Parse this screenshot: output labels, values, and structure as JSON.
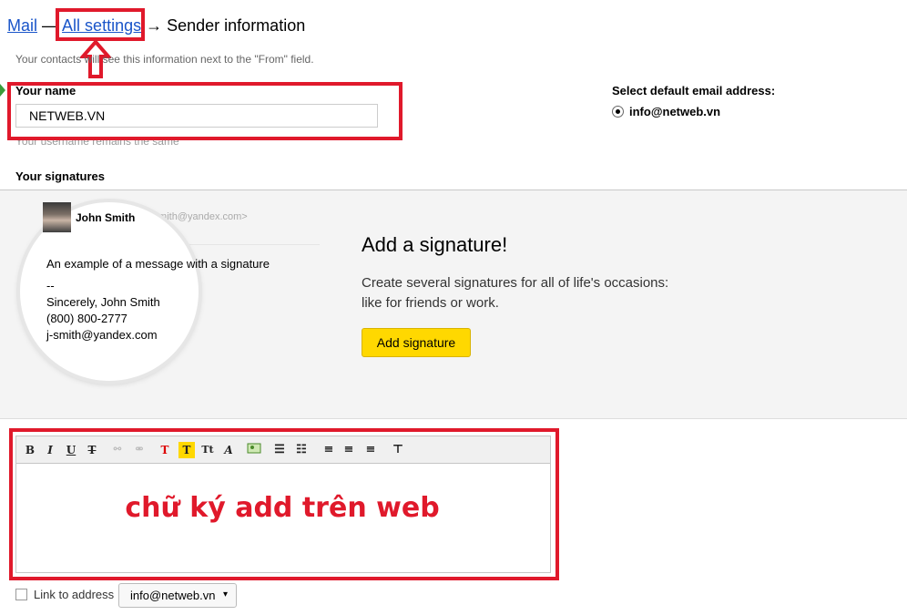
{
  "breadcrumb": {
    "mail": "Mail",
    "sep1": "—",
    "all_settings": "All settings",
    "sep2": "→",
    "current": "Sender information"
  },
  "hint": "Your contacts will see this information next to the \"From\" field.",
  "name": {
    "label": "Your name",
    "value": "NETWEB.VN",
    "note": "Your username remains the same"
  },
  "default_email": {
    "label": "Select default email address:",
    "option": "info@netweb.vn"
  },
  "signatures": {
    "heading": "Your signatures",
    "example": {
      "sender_name": "John Smith",
      "sender_email": "<j-smith@yandex.com>",
      "message": "An example of a message with a signature",
      "dashes": "--",
      "line1": "Sincerely, John Smith",
      "line2": "(800) 800-2777",
      "line3": "j-smith@yandex.com"
    },
    "promo_title": "Add a signature!",
    "promo_line1": "Create several signatures for all of life's occasions:",
    "promo_line2": "like for friends or work.",
    "add_button": "Add signature"
  },
  "editor": {
    "toolbar": [
      "B",
      "I",
      "U",
      "T",
      "link",
      "unlink",
      "T",
      "T",
      "Tt",
      "A",
      "image",
      "ul",
      "ol",
      "left",
      "center",
      "right",
      "clear"
    ],
    "overlay_text": "chữ ký add trên web"
  },
  "link_to_address": {
    "label": "Link to address",
    "value": "info@netweb.vn"
  },
  "colors": {
    "accent_red": "#e0192b",
    "link_blue": "#1a55c9",
    "button_yellow": "#ffd800"
  }
}
